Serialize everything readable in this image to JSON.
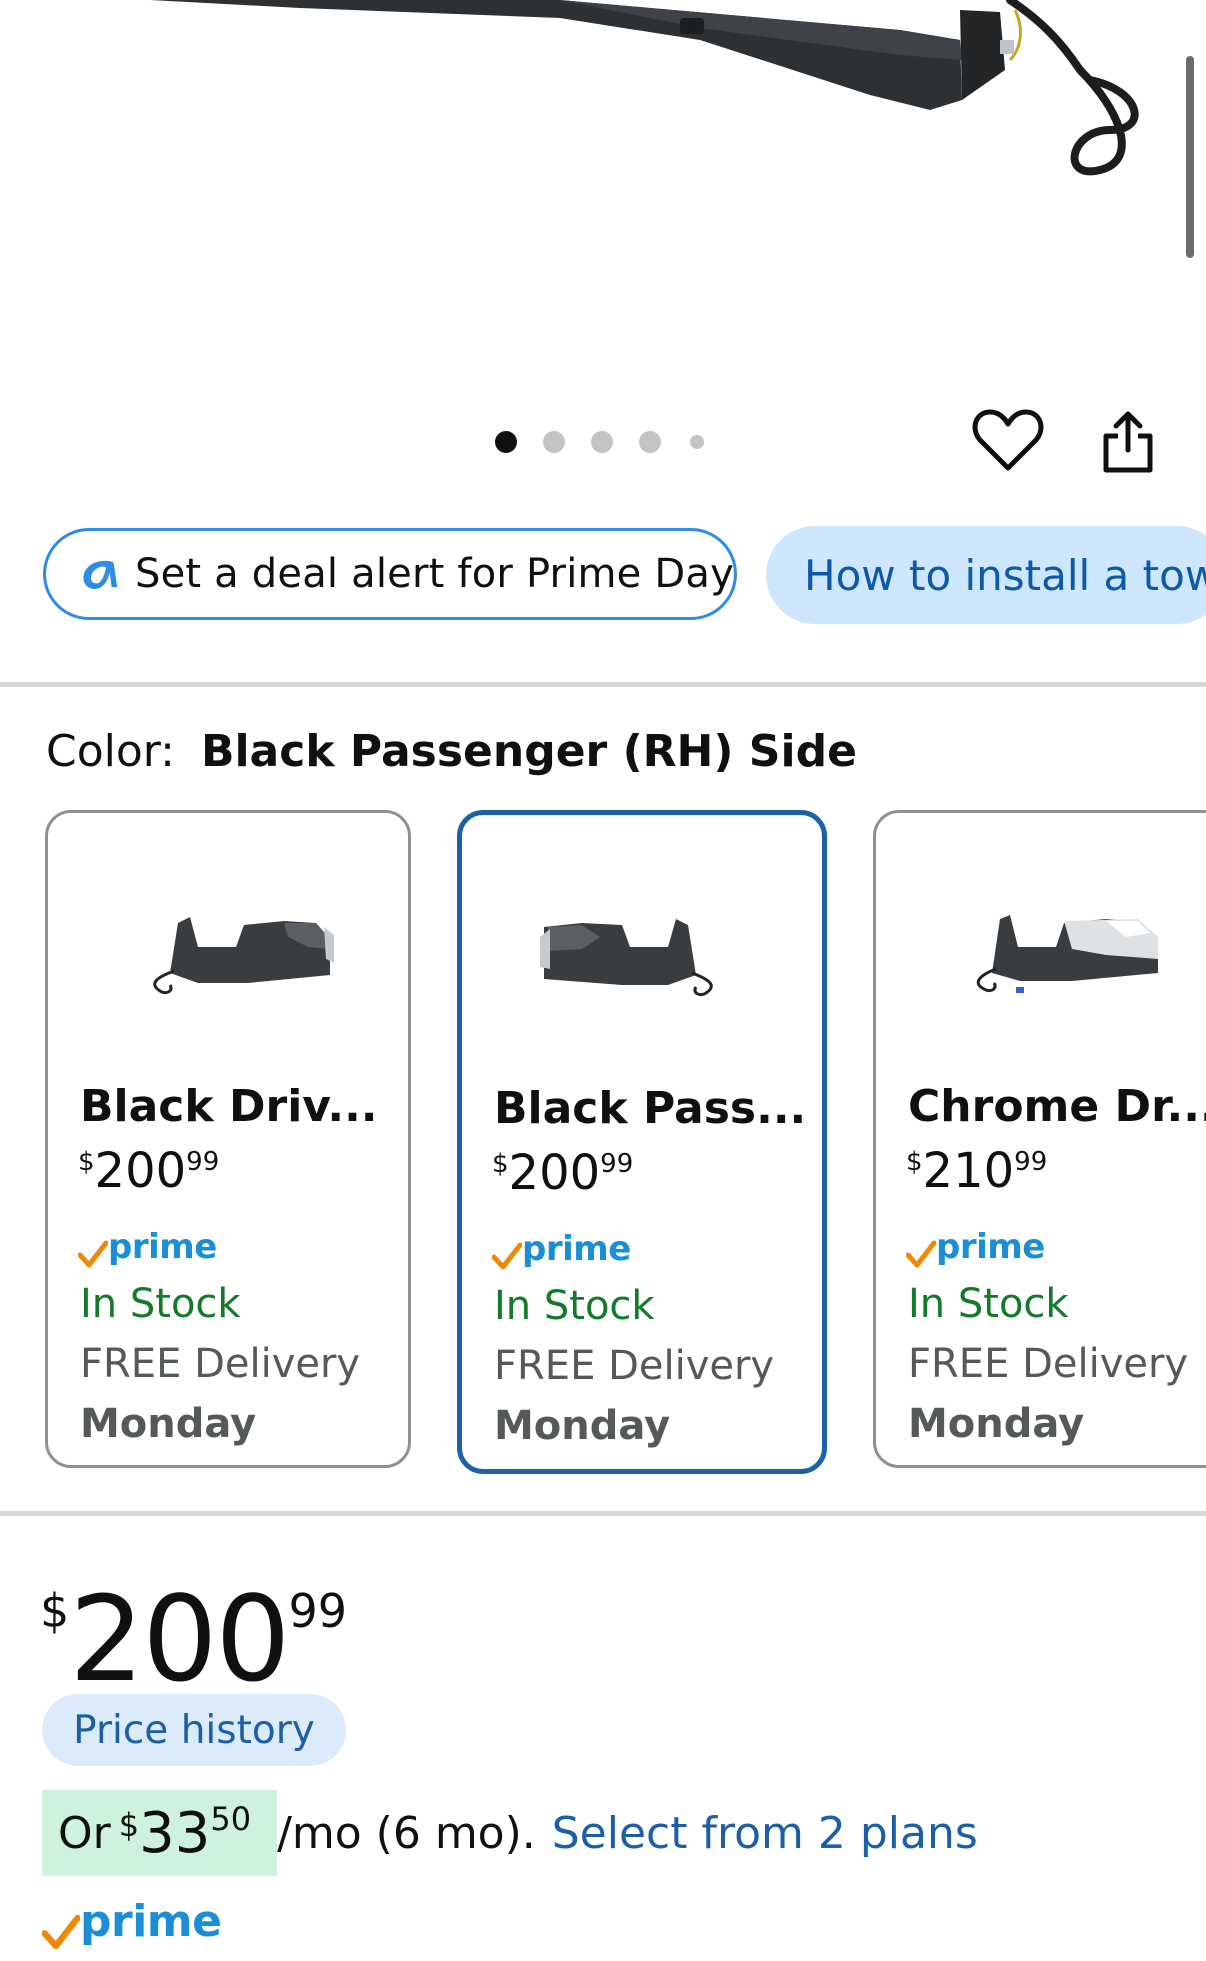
{
  "gallery": {
    "dots": 5,
    "active_dot": 0
  },
  "actions": {
    "favorite_icon": "heart-icon",
    "share_icon": "share-icon"
  },
  "pills": {
    "deal_alert": "Set a deal alert for Prime Day",
    "install": "How to install a tow"
  },
  "color": {
    "label": "Color:",
    "value": "Black Passenger (RH) Side"
  },
  "options": [
    {
      "name": "Black Driv...",
      "price_symbol": "$",
      "price_whole": "200",
      "price_fraction": "99",
      "prime": "prime",
      "stock": "In Stock",
      "delivery": "FREE Delivery",
      "day": "Monday",
      "selected": false
    },
    {
      "name": "Black Pass...",
      "price_symbol": "$",
      "price_whole": "200",
      "price_fraction": "99",
      "prime": "prime",
      "stock": "In Stock",
      "delivery": "FREE Delivery",
      "day": "Monday",
      "selected": true
    },
    {
      "name": "Chrome Dr...",
      "price_symbol": "$",
      "price_whole": "210",
      "price_fraction": "99",
      "prime": "prime",
      "stock": "In Stock",
      "delivery": "FREE Delivery",
      "day": "Monday",
      "selected": false
    }
  ],
  "price": {
    "symbol": "$",
    "whole": "200",
    "fraction": "99",
    "history_label": "Price history"
  },
  "installments": {
    "or": "Or",
    "symbol": "$",
    "whole": "33",
    "fraction": "50",
    "per": "/mo (6 mo).",
    "link": "Select from 2 plans"
  },
  "prime_badge": "prime",
  "colors": {
    "link_blue": "#1d5fa7",
    "prime_blue": "#1b8ed6",
    "prime_check": "#f08804",
    "stock_green": "#137a2a",
    "selected_border": "#1d62a8"
  }
}
